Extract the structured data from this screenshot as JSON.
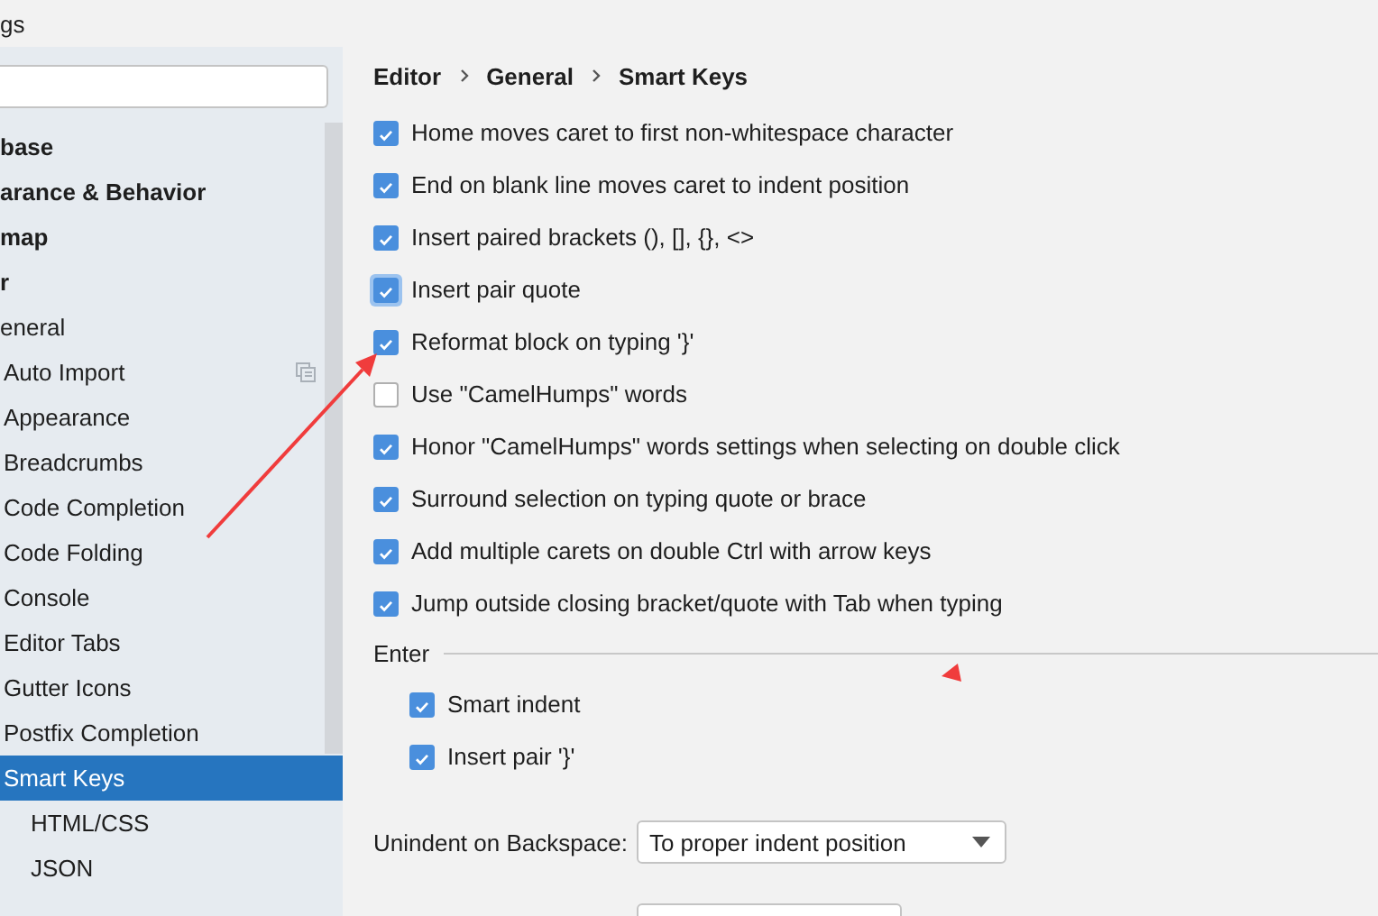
{
  "window": {
    "title": "gs"
  },
  "sidebar": {
    "items": [
      {
        "label": "base",
        "bold": true,
        "selected": false,
        "badge_icon": false
      },
      {
        "label": "arance & Behavior",
        "bold": true,
        "selected": false,
        "badge_icon": false
      },
      {
        "label": "map",
        "bold": true,
        "selected": false,
        "badge_icon": false
      },
      {
        "label": "r",
        "bold": true,
        "selected": false,
        "badge_icon": false,
        "children": [
          {
            "label": "eneral",
            "bold": false,
            "selected": false,
            "badge_icon": false,
            "children": [
              {
                "label": "Auto Import",
                "bold": false,
                "selected": false,
                "badge_icon": true
              },
              {
                "label": "Appearance",
                "bold": false,
                "selected": false,
                "badge_icon": false
              },
              {
                "label": "Breadcrumbs",
                "bold": false,
                "selected": false,
                "badge_icon": false
              },
              {
                "label": "Code Completion",
                "bold": false,
                "selected": false,
                "badge_icon": false
              },
              {
                "label": "Code Folding",
                "bold": false,
                "selected": false,
                "badge_icon": false
              },
              {
                "label": "Console",
                "bold": false,
                "selected": false,
                "badge_icon": false
              },
              {
                "label": "Editor Tabs",
                "bold": false,
                "selected": false,
                "badge_icon": false
              },
              {
                "label": "Gutter Icons",
                "bold": false,
                "selected": false,
                "badge_icon": false
              },
              {
                "label": "Postfix Completion",
                "bold": false,
                "selected": false,
                "badge_icon": false
              },
              {
                "label": "Smart Keys",
                "bold": false,
                "selected": true,
                "badge_icon": false,
                "children": [
                  {
                    "label": "HTML/CSS",
                    "bold": false,
                    "selected": false,
                    "badge_icon": false
                  },
                  {
                    "label": "JSON",
                    "bold": false,
                    "selected": false,
                    "badge_icon": false
                  }
                ]
              }
            ]
          }
        ]
      }
    ]
  },
  "breadcrumb": [
    "Editor",
    "General",
    "Smart Keys"
  ],
  "options": [
    {
      "label": "Home moves caret to first non-whitespace character",
      "checked": true,
      "focused": false
    },
    {
      "label": "End on blank line moves caret to indent position",
      "checked": true,
      "focused": false
    },
    {
      "label": "Insert paired brackets (), [], {}, <>",
      "checked": true,
      "focused": false
    },
    {
      "label": "Insert pair quote",
      "checked": true,
      "focused": true
    },
    {
      "label": "Reformat block on typing '}'",
      "checked": true,
      "focused": false
    },
    {
      "label": "Use \"CamelHumps\" words",
      "checked": false,
      "focused": false
    },
    {
      "label": "Honor \"CamelHumps\" words settings when selecting on double click",
      "checked": true,
      "focused": false
    },
    {
      "label": "Surround selection on typing quote or brace",
      "checked": true,
      "focused": false
    },
    {
      "label": "Add multiple carets on double Ctrl with arrow keys",
      "checked": true,
      "focused": false
    },
    {
      "label": "Jump outside closing bracket/quote with Tab when typing",
      "checked": true,
      "focused": false
    }
  ],
  "enter": {
    "title": "Enter",
    "options": [
      {
        "label": "Smart indent",
        "checked": true,
        "focused": false
      },
      {
        "label": "Insert pair '}'",
        "checked": true,
        "focused": false
      }
    ]
  },
  "unindent": {
    "label": "Unindent on Backspace:",
    "value": "To proper indent position"
  }
}
